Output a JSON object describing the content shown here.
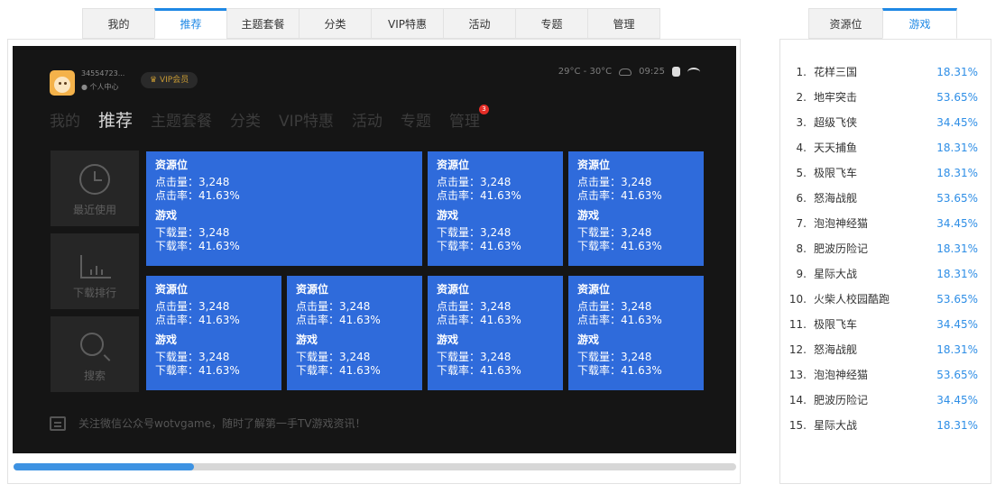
{
  "top_tabs": [
    "我的",
    "推荐",
    "主题套餐",
    "分类",
    "VIP特惠",
    "活动",
    "专题",
    "管理"
  ],
  "active_tab": "推荐",
  "tv": {
    "user_id": "34554723...",
    "user_center": "个人中心",
    "vip_label": "VIP会员",
    "temperature": "29°C - 30°C",
    "time": "09:25",
    "nav": [
      "我的",
      "推荐",
      "主题套餐",
      "分类",
      "VIP特惠",
      "活动",
      "专题",
      "管理"
    ],
    "nav_active": "推荐",
    "manage_badge": "3",
    "side_items": [
      "最近使用",
      "下载排行",
      "搜索"
    ],
    "tile_labels": {
      "ad_heading": "资源位",
      "click_count": "点击量：3,248",
      "click_rate": "点击率：41.63%",
      "game_heading": "游戏",
      "download_count": "下载量：3,248",
      "download_rate": "下载率：41.63%"
    },
    "footer_tip": "关注微信公众号wotvgame，随时了解第一手TV游戏资讯！"
  },
  "scroll_progress": 0.25,
  "right_tabs": [
    "资源位",
    "游戏"
  ],
  "right_active": "游戏",
  "ranking": [
    {
      "rank": "1.",
      "name": "花样三国",
      "pct": "18.31%"
    },
    {
      "rank": "2.",
      "name": "地牢突击",
      "pct": "53.65%"
    },
    {
      "rank": "3.",
      "name": "超级飞侠",
      "pct": "34.45%"
    },
    {
      "rank": "4.",
      "name": "天天捕鱼",
      "pct": "18.31%"
    },
    {
      "rank": "5.",
      "name": "极限飞车",
      "pct": "18.31%"
    },
    {
      "rank": "6.",
      "name": "怒海战舰",
      "pct": "53.65%"
    },
    {
      "rank": "7.",
      "name": "泡泡神经猫",
      "pct": "34.45%"
    },
    {
      "rank": "8.",
      "name": "肥波历险记",
      "pct": "18.31%"
    },
    {
      "rank": "9.",
      "name": "星际大战",
      "pct": "18.31%"
    },
    {
      "rank": "10.",
      "name": "火柴人校园酷跑",
      "pct": "53.65%"
    },
    {
      "rank": "11.",
      "name": "极限飞车",
      "pct": "34.45%"
    },
    {
      "rank": "12.",
      "name": "怒海战舰",
      "pct": "18.31%"
    },
    {
      "rank": "13.",
      "name": "泡泡神经猫",
      "pct": "53.65%"
    },
    {
      "rank": "14.",
      "name": "肥波历险记",
      "pct": "34.45%"
    },
    {
      "rank": "15.",
      "name": "星际大战",
      "pct": "18.31%"
    }
  ],
  "colors": {
    "accent": "#1e88e5",
    "tile": "#2f6bdb",
    "tv_bg": "#151515",
    "badge": "#e52d27"
  }
}
